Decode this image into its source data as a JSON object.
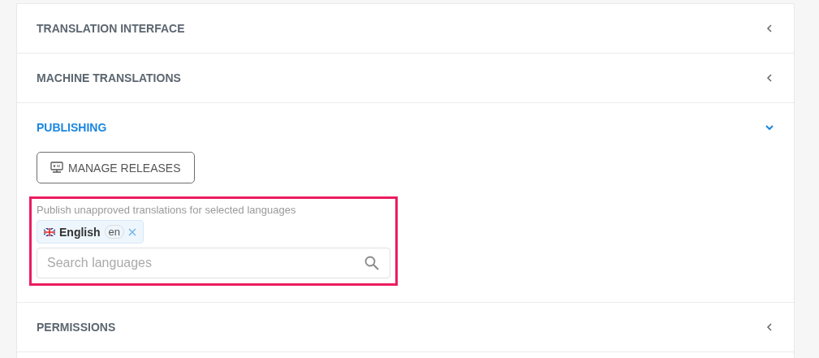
{
  "sections": [
    {
      "title": "TRANSLATION INTERFACE",
      "expanded": false
    },
    {
      "title": "MACHINE TRANSLATIONS",
      "expanded": false
    },
    {
      "title": "PUBLISHING",
      "expanded": true,
      "button": "MANAGE RELEASES",
      "highlighted": true,
      "field_label": "Publish unapproved translations for selected languages",
      "chips": [
        {
          "name": "English",
          "code": "en"
        }
      ],
      "search": {
        "placeholder": "Search languages"
      }
    },
    {
      "title": "PERMISSIONS",
      "expanded": false
    }
  ]
}
